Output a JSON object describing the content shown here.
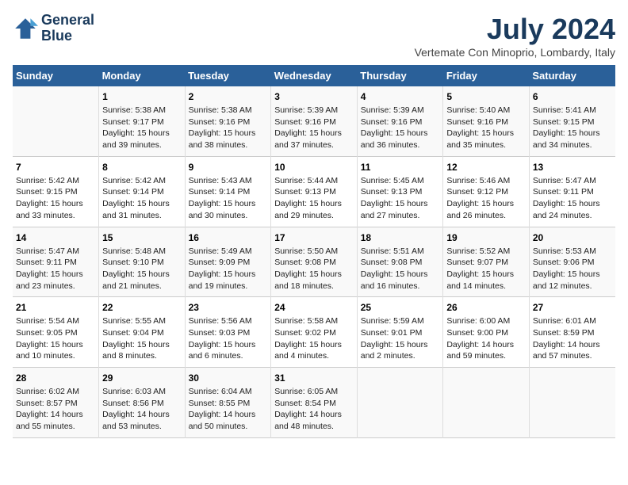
{
  "logo": {
    "line1": "General",
    "line2": "Blue"
  },
  "title": "July 2024",
  "subtitle": "Vertemate Con Minoprio, Lombardy, Italy",
  "days_of_week": [
    "Sunday",
    "Monday",
    "Tuesday",
    "Wednesday",
    "Thursday",
    "Friday",
    "Saturday"
  ],
  "weeks": [
    [
      {
        "day": "",
        "sunrise": "",
        "sunset": "",
        "daylight": ""
      },
      {
        "day": "1",
        "sunrise": "Sunrise: 5:38 AM",
        "sunset": "Sunset: 9:17 PM",
        "daylight": "Daylight: 15 hours and 39 minutes."
      },
      {
        "day": "2",
        "sunrise": "Sunrise: 5:38 AM",
        "sunset": "Sunset: 9:16 PM",
        "daylight": "Daylight: 15 hours and 38 minutes."
      },
      {
        "day": "3",
        "sunrise": "Sunrise: 5:39 AM",
        "sunset": "Sunset: 9:16 PM",
        "daylight": "Daylight: 15 hours and 37 minutes."
      },
      {
        "day": "4",
        "sunrise": "Sunrise: 5:39 AM",
        "sunset": "Sunset: 9:16 PM",
        "daylight": "Daylight: 15 hours and 36 minutes."
      },
      {
        "day": "5",
        "sunrise": "Sunrise: 5:40 AM",
        "sunset": "Sunset: 9:16 PM",
        "daylight": "Daylight: 15 hours and 35 minutes."
      },
      {
        "day": "6",
        "sunrise": "Sunrise: 5:41 AM",
        "sunset": "Sunset: 9:15 PM",
        "daylight": "Daylight: 15 hours and 34 minutes."
      }
    ],
    [
      {
        "day": "7",
        "sunrise": "Sunrise: 5:42 AM",
        "sunset": "Sunset: 9:15 PM",
        "daylight": "Daylight: 15 hours and 33 minutes."
      },
      {
        "day": "8",
        "sunrise": "Sunrise: 5:42 AM",
        "sunset": "Sunset: 9:14 PM",
        "daylight": "Daylight: 15 hours and 31 minutes."
      },
      {
        "day": "9",
        "sunrise": "Sunrise: 5:43 AM",
        "sunset": "Sunset: 9:14 PM",
        "daylight": "Daylight: 15 hours and 30 minutes."
      },
      {
        "day": "10",
        "sunrise": "Sunrise: 5:44 AM",
        "sunset": "Sunset: 9:13 PM",
        "daylight": "Daylight: 15 hours and 29 minutes."
      },
      {
        "day": "11",
        "sunrise": "Sunrise: 5:45 AM",
        "sunset": "Sunset: 9:13 PM",
        "daylight": "Daylight: 15 hours and 27 minutes."
      },
      {
        "day": "12",
        "sunrise": "Sunrise: 5:46 AM",
        "sunset": "Sunset: 9:12 PM",
        "daylight": "Daylight: 15 hours and 26 minutes."
      },
      {
        "day": "13",
        "sunrise": "Sunrise: 5:47 AM",
        "sunset": "Sunset: 9:11 PM",
        "daylight": "Daylight: 15 hours and 24 minutes."
      }
    ],
    [
      {
        "day": "14",
        "sunrise": "Sunrise: 5:47 AM",
        "sunset": "Sunset: 9:11 PM",
        "daylight": "Daylight: 15 hours and 23 minutes."
      },
      {
        "day": "15",
        "sunrise": "Sunrise: 5:48 AM",
        "sunset": "Sunset: 9:10 PM",
        "daylight": "Daylight: 15 hours and 21 minutes."
      },
      {
        "day": "16",
        "sunrise": "Sunrise: 5:49 AM",
        "sunset": "Sunset: 9:09 PM",
        "daylight": "Daylight: 15 hours and 19 minutes."
      },
      {
        "day": "17",
        "sunrise": "Sunrise: 5:50 AM",
        "sunset": "Sunset: 9:08 PM",
        "daylight": "Daylight: 15 hours and 18 minutes."
      },
      {
        "day": "18",
        "sunrise": "Sunrise: 5:51 AM",
        "sunset": "Sunset: 9:08 PM",
        "daylight": "Daylight: 15 hours and 16 minutes."
      },
      {
        "day": "19",
        "sunrise": "Sunrise: 5:52 AM",
        "sunset": "Sunset: 9:07 PM",
        "daylight": "Daylight: 15 hours and 14 minutes."
      },
      {
        "day": "20",
        "sunrise": "Sunrise: 5:53 AM",
        "sunset": "Sunset: 9:06 PM",
        "daylight": "Daylight: 15 hours and 12 minutes."
      }
    ],
    [
      {
        "day": "21",
        "sunrise": "Sunrise: 5:54 AM",
        "sunset": "Sunset: 9:05 PM",
        "daylight": "Daylight: 15 hours and 10 minutes."
      },
      {
        "day": "22",
        "sunrise": "Sunrise: 5:55 AM",
        "sunset": "Sunset: 9:04 PM",
        "daylight": "Daylight: 15 hours and 8 minutes."
      },
      {
        "day": "23",
        "sunrise": "Sunrise: 5:56 AM",
        "sunset": "Sunset: 9:03 PM",
        "daylight": "Daylight: 15 hours and 6 minutes."
      },
      {
        "day": "24",
        "sunrise": "Sunrise: 5:58 AM",
        "sunset": "Sunset: 9:02 PM",
        "daylight": "Daylight: 15 hours and 4 minutes."
      },
      {
        "day": "25",
        "sunrise": "Sunrise: 5:59 AM",
        "sunset": "Sunset: 9:01 PM",
        "daylight": "Daylight: 15 hours and 2 minutes."
      },
      {
        "day": "26",
        "sunrise": "Sunrise: 6:00 AM",
        "sunset": "Sunset: 9:00 PM",
        "daylight": "Daylight: 14 hours and 59 minutes."
      },
      {
        "day": "27",
        "sunrise": "Sunrise: 6:01 AM",
        "sunset": "Sunset: 8:59 PM",
        "daylight": "Daylight: 14 hours and 57 minutes."
      }
    ],
    [
      {
        "day": "28",
        "sunrise": "Sunrise: 6:02 AM",
        "sunset": "Sunset: 8:57 PM",
        "daylight": "Daylight: 14 hours and 55 minutes."
      },
      {
        "day": "29",
        "sunrise": "Sunrise: 6:03 AM",
        "sunset": "Sunset: 8:56 PM",
        "daylight": "Daylight: 14 hours and 53 minutes."
      },
      {
        "day": "30",
        "sunrise": "Sunrise: 6:04 AM",
        "sunset": "Sunset: 8:55 PM",
        "daylight": "Daylight: 14 hours and 50 minutes."
      },
      {
        "day": "31",
        "sunrise": "Sunrise: 6:05 AM",
        "sunset": "Sunset: 8:54 PM",
        "daylight": "Daylight: 14 hours and 48 minutes."
      },
      {
        "day": "",
        "sunrise": "",
        "sunset": "",
        "daylight": ""
      },
      {
        "day": "",
        "sunrise": "",
        "sunset": "",
        "daylight": ""
      },
      {
        "day": "",
        "sunrise": "",
        "sunset": "",
        "daylight": ""
      }
    ]
  ]
}
